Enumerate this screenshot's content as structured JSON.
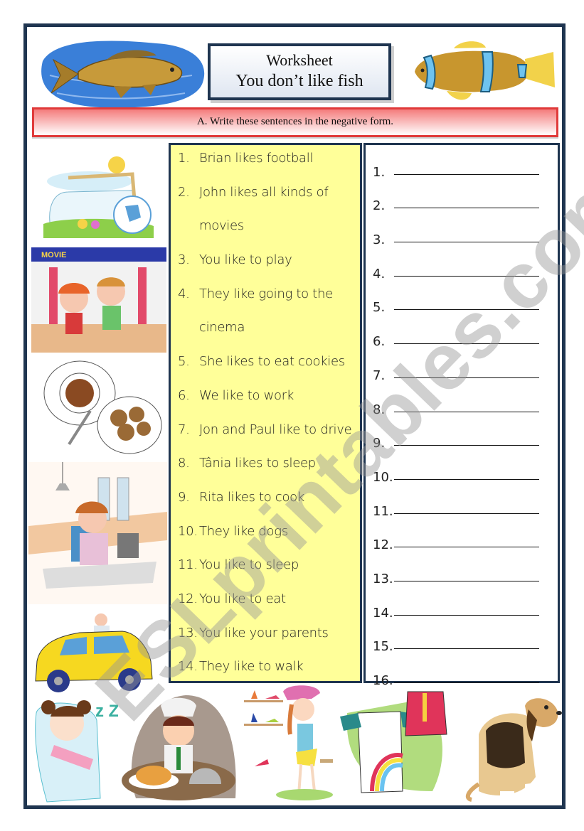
{
  "header": {
    "title_line1": "Worksheet",
    "title_line2": "You don’t like fish"
  },
  "instruction": "A. Write these sentences in the negative form.",
  "sentences": [
    {
      "num": "1.",
      "text": "Brian likes football"
    },
    {
      "num": "2.",
      "text": "John likes all kinds of"
    },
    {
      "num": "",
      "text": "movies"
    },
    {
      "num": "3.",
      "text": "You like to play"
    },
    {
      "num": "4.",
      "text": "They like going to the"
    },
    {
      "num": "",
      "text": "cinema"
    },
    {
      "num": "5.",
      "text": "She likes to eat cookies"
    },
    {
      "num": "6.",
      "text": "We like to work"
    },
    {
      "num": "7.",
      "text": "Jon and Paul like to drive"
    },
    {
      "num": "8.",
      "text": "Tânia likes to sleep"
    },
    {
      "num": "9.",
      "text": "Rita likes to cook"
    },
    {
      "num": "10.",
      "text": "They like dogs"
    },
    {
      "num": "11.",
      "text": "You like to sleep"
    },
    {
      "num": "12.",
      "text": "You like to eat"
    },
    {
      "num": "13.",
      "text": "You like your parents"
    },
    {
      "num": "14.",
      "text": "They like to walk"
    }
  ],
  "answers": [
    "1.",
    "2.",
    "3.",
    "4.",
    "5.",
    "6.",
    "7.",
    "8.",
    "9.",
    "10.",
    "11.",
    "12.",
    "13.",
    "14.",
    "15.",
    "16."
  ],
  "watermark": "ESLprintables.com",
  "illustrations": {
    "top_left": "carp-fish-illustration",
    "top_right": "clownfish-illustration",
    "left": [
      "football-goal-illustration",
      "movie-theater-kids-illustration",
      "coffee-cookies-illustration",
      "office-worker-illustration",
      "yellow-car-illustration"
    ],
    "bottom": [
      "sleeping-girl-illustration",
      "chef-cooking-illustration",
      "girl-shoes-shopping-illustration",
      "clothes-rainbow-illustration",
      "beagle-dog-illustration"
    ]
  },
  "colors": {
    "frame": "#1f3550",
    "banner_border": "#e03a3a",
    "sentence_bg": "#ffff99"
  }
}
